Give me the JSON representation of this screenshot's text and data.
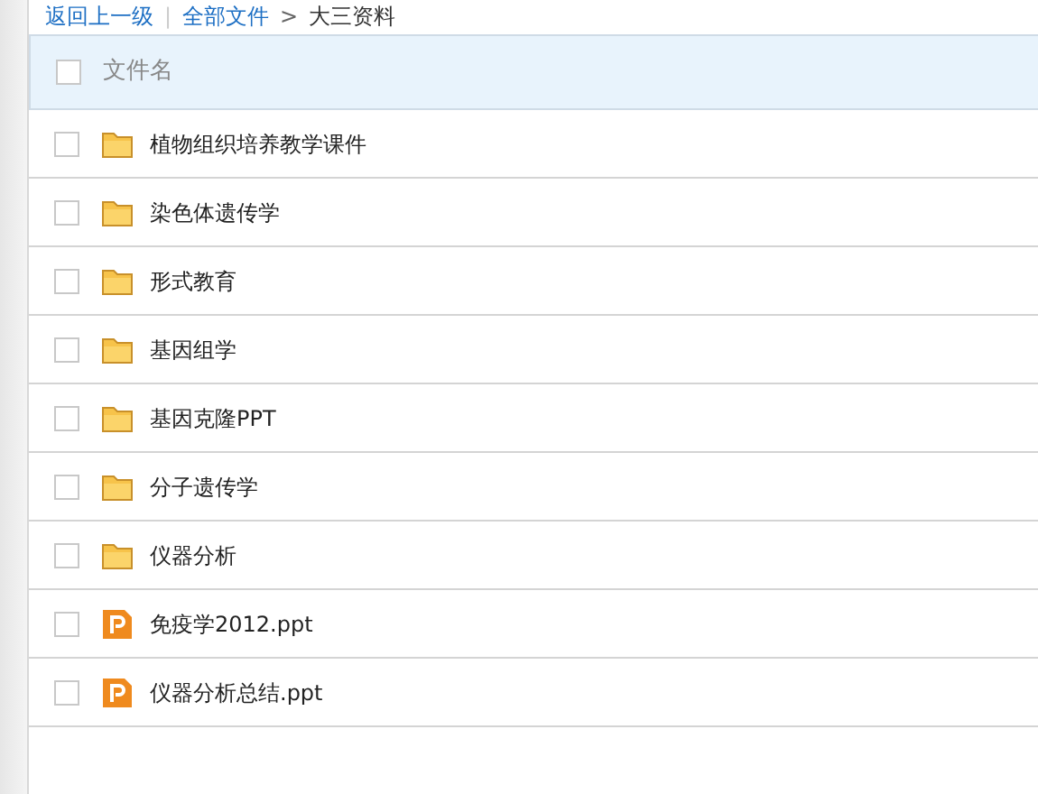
{
  "breadcrumb": {
    "back": "返回上一级",
    "separator": "|",
    "root": "全部文件",
    "arrow": ">",
    "current": "大三资料"
  },
  "header": {
    "checked": false,
    "column": "文件名"
  },
  "files": [
    {
      "kind": "folder",
      "name": "植物组织培养教学课件",
      "checked": false
    },
    {
      "kind": "folder",
      "name": "染色体遗传学",
      "checked": false
    },
    {
      "kind": "folder",
      "name": "形式教育",
      "checked": false
    },
    {
      "kind": "folder",
      "name": "基因组学",
      "checked": false
    },
    {
      "kind": "folder",
      "name": "基因克隆PPT",
      "checked": false
    },
    {
      "kind": "folder",
      "name": "分子遗传学",
      "checked": false
    },
    {
      "kind": "folder",
      "name": "仪器分析",
      "checked": false
    },
    {
      "kind": "ppt",
      "name": "免疫学2012.ppt",
      "checked": false
    },
    {
      "kind": "ppt",
      "name": "仪器分析总结.ppt",
      "checked": false
    }
  ]
}
